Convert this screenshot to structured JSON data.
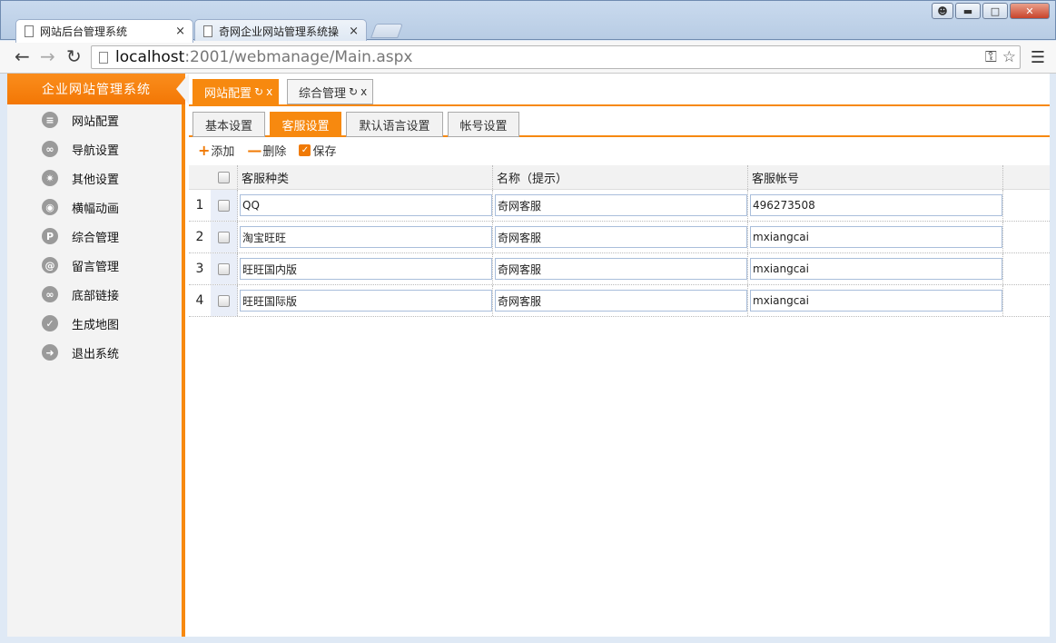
{
  "browser": {
    "tabs": [
      {
        "title": "网站后台管理系统",
        "close": "×"
      },
      {
        "title": "奇网企业网站管理系统操",
        "close": "×"
      }
    ],
    "url_host": "localhost",
    "url_rest": ":2001/webmanage/Main.aspx"
  },
  "sidebar": {
    "brand": "企业网站管理系统",
    "items": [
      {
        "label": "网站配置",
        "icon": "list-icon",
        "glyph": "≡"
      },
      {
        "label": "导航设置",
        "icon": "link-icon",
        "glyph": "∞"
      },
      {
        "label": "其他设置",
        "icon": "gear-icon",
        "glyph": "✷"
      },
      {
        "label": "横幅动画",
        "icon": "camera-icon",
        "glyph": "◉"
      },
      {
        "label": "综合管理",
        "icon": "p-icon",
        "glyph": "P"
      },
      {
        "label": "留言管理",
        "icon": "at-icon",
        "glyph": "@"
      },
      {
        "label": "底部链接",
        "icon": "link-icon",
        "glyph": "∞"
      },
      {
        "label": "生成地图",
        "icon": "check-icon",
        "glyph": "✓"
      },
      {
        "label": "退出系统",
        "icon": "arrow-right-icon",
        "glyph": "➜"
      }
    ]
  },
  "main": {
    "top_tabs": [
      {
        "label": "网站配置",
        "refresh": "↻",
        "close": "x"
      },
      {
        "label": "综合管理",
        "refresh": "↻",
        "close": "x"
      }
    ],
    "sub_tabs": [
      "基本设置",
      "客服设置",
      "默认语言设置",
      "帐号设置"
    ],
    "actions": {
      "add": "添加",
      "delete": "删除",
      "save": "保存"
    },
    "grid": {
      "headers": [
        "客服种类",
        "名称（提示）",
        "客服帐号"
      ],
      "rows": [
        {
          "num": "1",
          "type": "QQ",
          "name": "奇网客服",
          "account": "496273508"
        },
        {
          "num": "2",
          "type": "淘宝旺旺",
          "name": "奇网客服",
          "account": "mxiangcai"
        },
        {
          "num": "3",
          "type": "旺旺国内版",
          "name": "奇网客服",
          "account": "mxiangcai"
        },
        {
          "num": "4",
          "type": "旺旺国际版",
          "name": "奇网客服",
          "account": "mxiangcai"
        }
      ]
    }
  }
}
